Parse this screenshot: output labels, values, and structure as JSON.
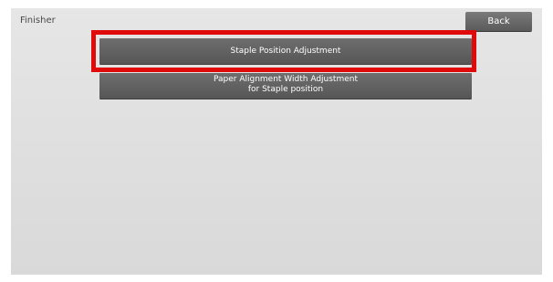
{
  "screen": {
    "title": "Finisher",
    "back_label": "Back"
  },
  "menu": {
    "items": [
      {
        "label": "Staple Position Adjustment"
      },
      {
        "line1": "Paper Alignment Width Adjustment",
        "line2": "for Staple position"
      }
    ]
  },
  "colors": {
    "highlight": "#e10a0a",
    "button_bg": "#626262",
    "screen_bg": "#dedede"
  }
}
